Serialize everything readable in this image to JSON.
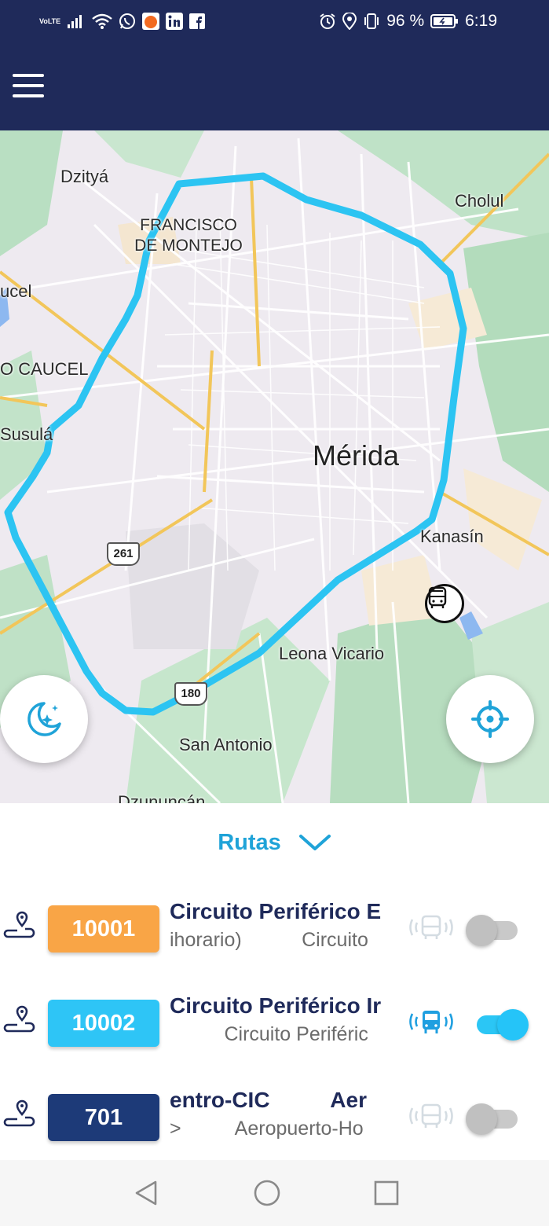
{
  "status_bar": {
    "volte_top": "Vo",
    "volte_bottom": "LTE",
    "battery": "96 %",
    "time": "6:19"
  },
  "app_bar": {
    "menu_icon": "hamburger-menu-icon"
  },
  "map": {
    "labels": {
      "dzitya": "Dzityá",
      "cholul": "Cholul",
      "francisco_line1": "FRANCISCO",
      "francisco_line2": "DE MONTEJO",
      "caucel": "ucel",
      "ciudad_caucel": "O CAUCEL",
      "susula": "Susulá",
      "merida": "Mérida",
      "kanasin": "Kanasín",
      "leona_vicario": "Leona Vicario",
      "san_antonio": "San Antonio",
      "dzununcan": "Dzununcán"
    },
    "shields": {
      "hwy_261": "261",
      "hwy_180": "180"
    },
    "route_color": "#2cc4f2"
  },
  "sheet": {
    "title": "Rutas",
    "routes": [
      {
        "number": "10001",
        "badge_color": "#f9a546",
        "name": "Circuito Periférico E",
        "sub": "ihorario)           Circuito",
        "active": false
      },
      {
        "number": "10002",
        "badge_color": "#2ec5f6",
        "name": "Circuito Periférico Ir",
        "sub": "          Circuito Periféric",
        "active": true
      },
      {
        "number": "701",
        "badge_color": "#1d3a78",
        "name": "entro-CIC          Aer",
        "sub": ">          Aeropuerto-Ho",
        "active": false
      }
    ]
  },
  "colors": {
    "navy": "#1f2a5a",
    "accent": "#1fa3d8",
    "active_blue": "#2bc6f5"
  }
}
